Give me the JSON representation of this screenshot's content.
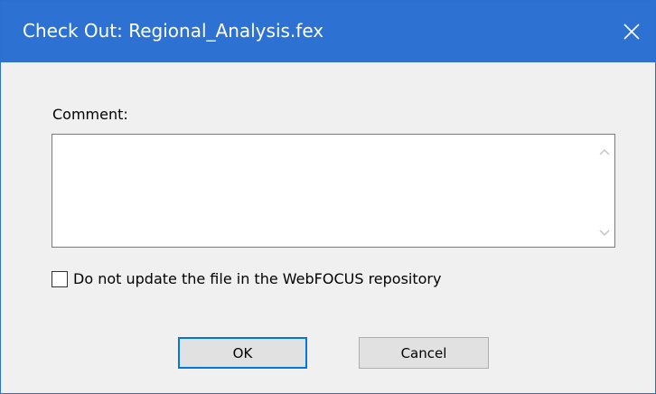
{
  "window": {
    "title": "Check Out: Regional_Analysis.fex",
    "close_icon": "close-icon"
  },
  "form": {
    "comment_label": "Comment:",
    "comment_value": "",
    "scroll_up_icon": "chevron-up-icon",
    "scroll_down_icon": "chevron-down-icon",
    "checkbox_label": "Do not update the file in the WebFOCUS repository",
    "checkbox_checked": false
  },
  "buttons": {
    "ok_label": "OK",
    "cancel_label": "Cancel"
  },
  "colors": {
    "titlebar": "#2d72d2",
    "dialog_background": "#f0f0f0",
    "default_button_border": "#0078d7"
  }
}
